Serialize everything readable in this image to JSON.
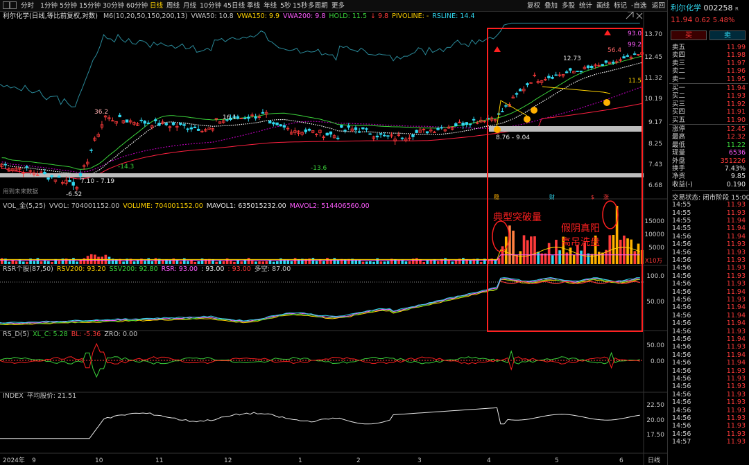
{
  "toolbar": {
    "left": [
      "分时",
      "1分钟",
      "5分钟",
      "15分钟",
      "30分钟",
      "60分钟",
      "日线",
      "周线",
      "月线",
      "10分钟",
      "45日线",
      "季线",
      "年线",
      "5秒",
      "15秒",
      "多周期",
      "更多"
    ],
    "active": "日线",
    "right": [
      "复权",
      "叠加",
      "多股",
      "统计",
      "画线",
      "标记",
      "-自选",
      "返回"
    ]
  },
  "main_header": {
    "title": "利尔化学(日线,等比前复权,对数)",
    "items": [
      {
        "text": "M6(10,20,50,150,200,13)",
        "color": "#c8c8c8"
      },
      {
        "text": "VWA50: 10.8",
        "color": "#c8c8c8"
      },
      {
        "text": "VWA150: 9.9",
        "color": "#ffd200"
      },
      {
        "text": "VWA200: 9.8",
        "color": "#ff5cff"
      },
      {
        "text": "HOLD: 11.5",
        "color": "#3bd43b"
      },
      {
        "text": "↓ 9.8",
        "color": "#ff3b3b"
      },
      {
        "text": "PIVOLINE: -",
        "color": "#ffd200"
      },
      {
        "text": "RSLINE: 14.4",
        "color": "#30d8f0"
      }
    ]
  },
  "vol_header": {
    "items": [
      {
        "text": "VOL_金(5,25)",
        "color": "#c8c8c8"
      },
      {
        "text": "VVOL: 704001152.00",
        "color": "#c8c8c8"
      },
      {
        "text": "VOLUME: 704001152.00",
        "color": "#ffd200"
      },
      {
        "text": "MAVOL1: 635015232.00",
        "color": "#e8e8e8"
      },
      {
        "text": "MAVOL2: 514406560.00",
        "color": "#ff5cff"
      }
    ]
  },
  "rsr_header": {
    "items": [
      {
        "text": "RSR个股(87,50)",
        "color": "#c8c8c8"
      },
      {
        "text": "RSV200: 93.20",
        "color": "#ffd200"
      },
      {
        "text": "SSV200: 92.80",
        "color": "#3bd43b"
      },
      {
        "text": "RSR: 93.00",
        "color": "#ff5cff"
      },
      {
        "text": ": 93.00",
        "color": "#e8e8e8"
      },
      {
        "text": ": 93.00",
        "color": "#ff3b3b"
      },
      {
        "text": "多空: 87.00",
        "color": "#c8c8c8"
      }
    ]
  },
  "rsd_header": {
    "items": [
      {
        "text": "RS_D(5)",
        "color": "#c8c8c8"
      },
      {
        "text": "XL_C: 5.28",
        "color": "#3bd43b"
      },
      {
        "text": "BL: -5.36",
        "color": "#ff3b3b"
      },
      {
        "text": "ZRO: 0.00",
        "color": "#c8c8c8"
      }
    ]
  },
  "index_header": {
    "items": [
      {
        "text": "INDEX",
        "color": "#c8c8c8"
      },
      {
        "text": "平均股价: 21.51",
        "color": "#c8c8c8"
      }
    ]
  },
  "price_axis": [
    "13.70",
    "12.45",
    "11.32",
    "10.19",
    "9.17",
    "8.25",
    "7.43",
    "6.68"
  ],
  "vol_axis": [
    "15000",
    "10000",
    "5000"
  ],
  "vol_unit": "X10万",
  "rsr_axis": [
    "100.0",
    "50.00"
  ],
  "rsd_axis": [
    "50.00",
    "0.00"
  ],
  "index_axis": [
    "22.50",
    "20.00",
    "17.50"
  ],
  "x_axis": [
    "2024年",
    "9",
    "10",
    "11",
    "12",
    "1",
    "2",
    "3",
    "4",
    "5",
    "6"
  ],
  "x_axis_right": "日线",
  "annotations": {
    "high1": "36.2",
    "high2": "16.1",
    "low1": "-14.3",
    "low2": "-13.6",
    "range1": "7.10 - 7.19",
    "low3": "-6.52",
    "range2": "8.76 - 9.04",
    "peak1": "12.73",
    "peak2": "56.4",
    "val93": "93.0",
    "val992": "99.2",
    "val115": "11.5",
    "note_future": "用到未来数据",
    "breakout": "典型突破量",
    "fake_yin1": "假阴真阳",
    "fake_yin2": "高吊洗盘",
    "tag_wen": "稳",
    "tag_cai": "财",
    "tag_s": "$",
    "tag_zhang": "涨"
  },
  "stock": {
    "name": "利尔化学",
    "code": "002258",
    "tag": "R",
    "price": "11.94",
    "change": "0.62",
    "pct": "5.48%",
    "buy_label": "买",
    "sell_label": "卖"
  },
  "order_book": {
    "asks": [
      {
        "label": "卖五",
        "price": "11.99"
      },
      {
        "label": "卖四",
        "price": "11.98"
      },
      {
        "label": "卖三",
        "price": "11.97"
      },
      {
        "label": "卖二",
        "price": "11.96"
      },
      {
        "label": "卖一",
        "price": "11.95"
      }
    ],
    "bids": [
      {
        "label": "买一",
        "price": "11.94"
      },
      {
        "label": "买二",
        "price": "11.93"
      },
      {
        "label": "买三",
        "price": "11.92"
      },
      {
        "label": "买四",
        "price": "11.91"
      },
      {
        "label": "买五",
        "price": "11.90"
      }
    ]
  },
  "stats": [
    {
      "label": "涨停",
      "value": "12.45",
      "color": "red"
    },
    {
      "label": "最高",
      "value": "12.32",
      "color": "red"
    },
    {
      "label": "最低",
      "value": "11.22",
      "color": "green"
    },
    {
      "label": "现量",
      "value": "6536",
      "color": "magenta"
    },
    {
      "label": "外盘",
      "value": "351226",
      "color": "red"
    },
    {
      "label": "换手",
      "value": "7.43%",
      "color": "white"
    },
    {
      "label": "净资",
      "value": "9.85",
      "color": "white"
    },
    {
      "label": "收益(-)",
      "value": "0.190",
      "color": "white"
    }
  ],
  "status": "交易状态: 闭市阶段 15:00",
  "ticks": [
    {
      "t": "14:55",
      "p": "11.93"
    },
    {
      "t": "14:55",
      "p": "11.93"
    },
    {
      "t": "14:55",
      "p": "11.94"
    },
    {
      "t": "14:55",
      "p": "11.94"
    },
    {
      "t": "14:56",
      "p": "11.94"
    },
    {
      "t": "14:56",
      "p": "11.93"
    },
    {
      "t": "14:56",
      "p": "11.93"
    },
    {
      "t": "14:56",
      "p": "11.93"
    },
    {
      "t": "14:56",
      "p": "11.93"
    },
    {
      "t": "14:56",
      "p": "11.93"
    },
    {
      "t": "14:56",
      "p": "11.93"
    },
    {
      "t": "14:56",
      "p": "11.94"
    },
    {
      "t": "14:56",
      "p": "11.93"
    },
    {
      "t": "14:56",
      "p": "11.94"
    },
    {
      "t": "14:56",
      "p": "11.94"
    },
    {
      "t": "14:56",
      "p": "11.94"
    },
    {
      "t": "14:56",
      "p": "11.93"
    },
    {
      "t": "14:56",
      "p": "11.94"
    },
    {
      "t": "14:56",
      "p": "11.93"
    },
    {
      "t": "14:56",
      "p": "11.94"
    },
    {
      "t": "14:56",
      "p": "11.94"
    },
    {
      "t": "14:56",
      "p": "11.93"
    },
    {
      "t": "14:56",
      "p": "11.93"
    },
    {
      "t": "14:56",
      "p": "11.93"
    },
    {
      "t": "14:56",
      "p": "11.93"
    },
    {
      "t": "14:56",
      "p": "11.93"
    },
    {
      "t": "14:56",
      "p": "11.93"
    },
    {
      "t": "14:56",
      "p": "11.93"
    },
    {
      "t": "14:56",
      "p": "11.93"
    },
    {
      "t": "14:56",
      "p": "11.93"
    },
    {
      "t": "14:57",
      "p": "11.93"
    }
  ],
  "colors": {
    "up": "#ff3b3b",
    "down": "#30d8f0",
    "highlight": "#ff2020"
  }
}
